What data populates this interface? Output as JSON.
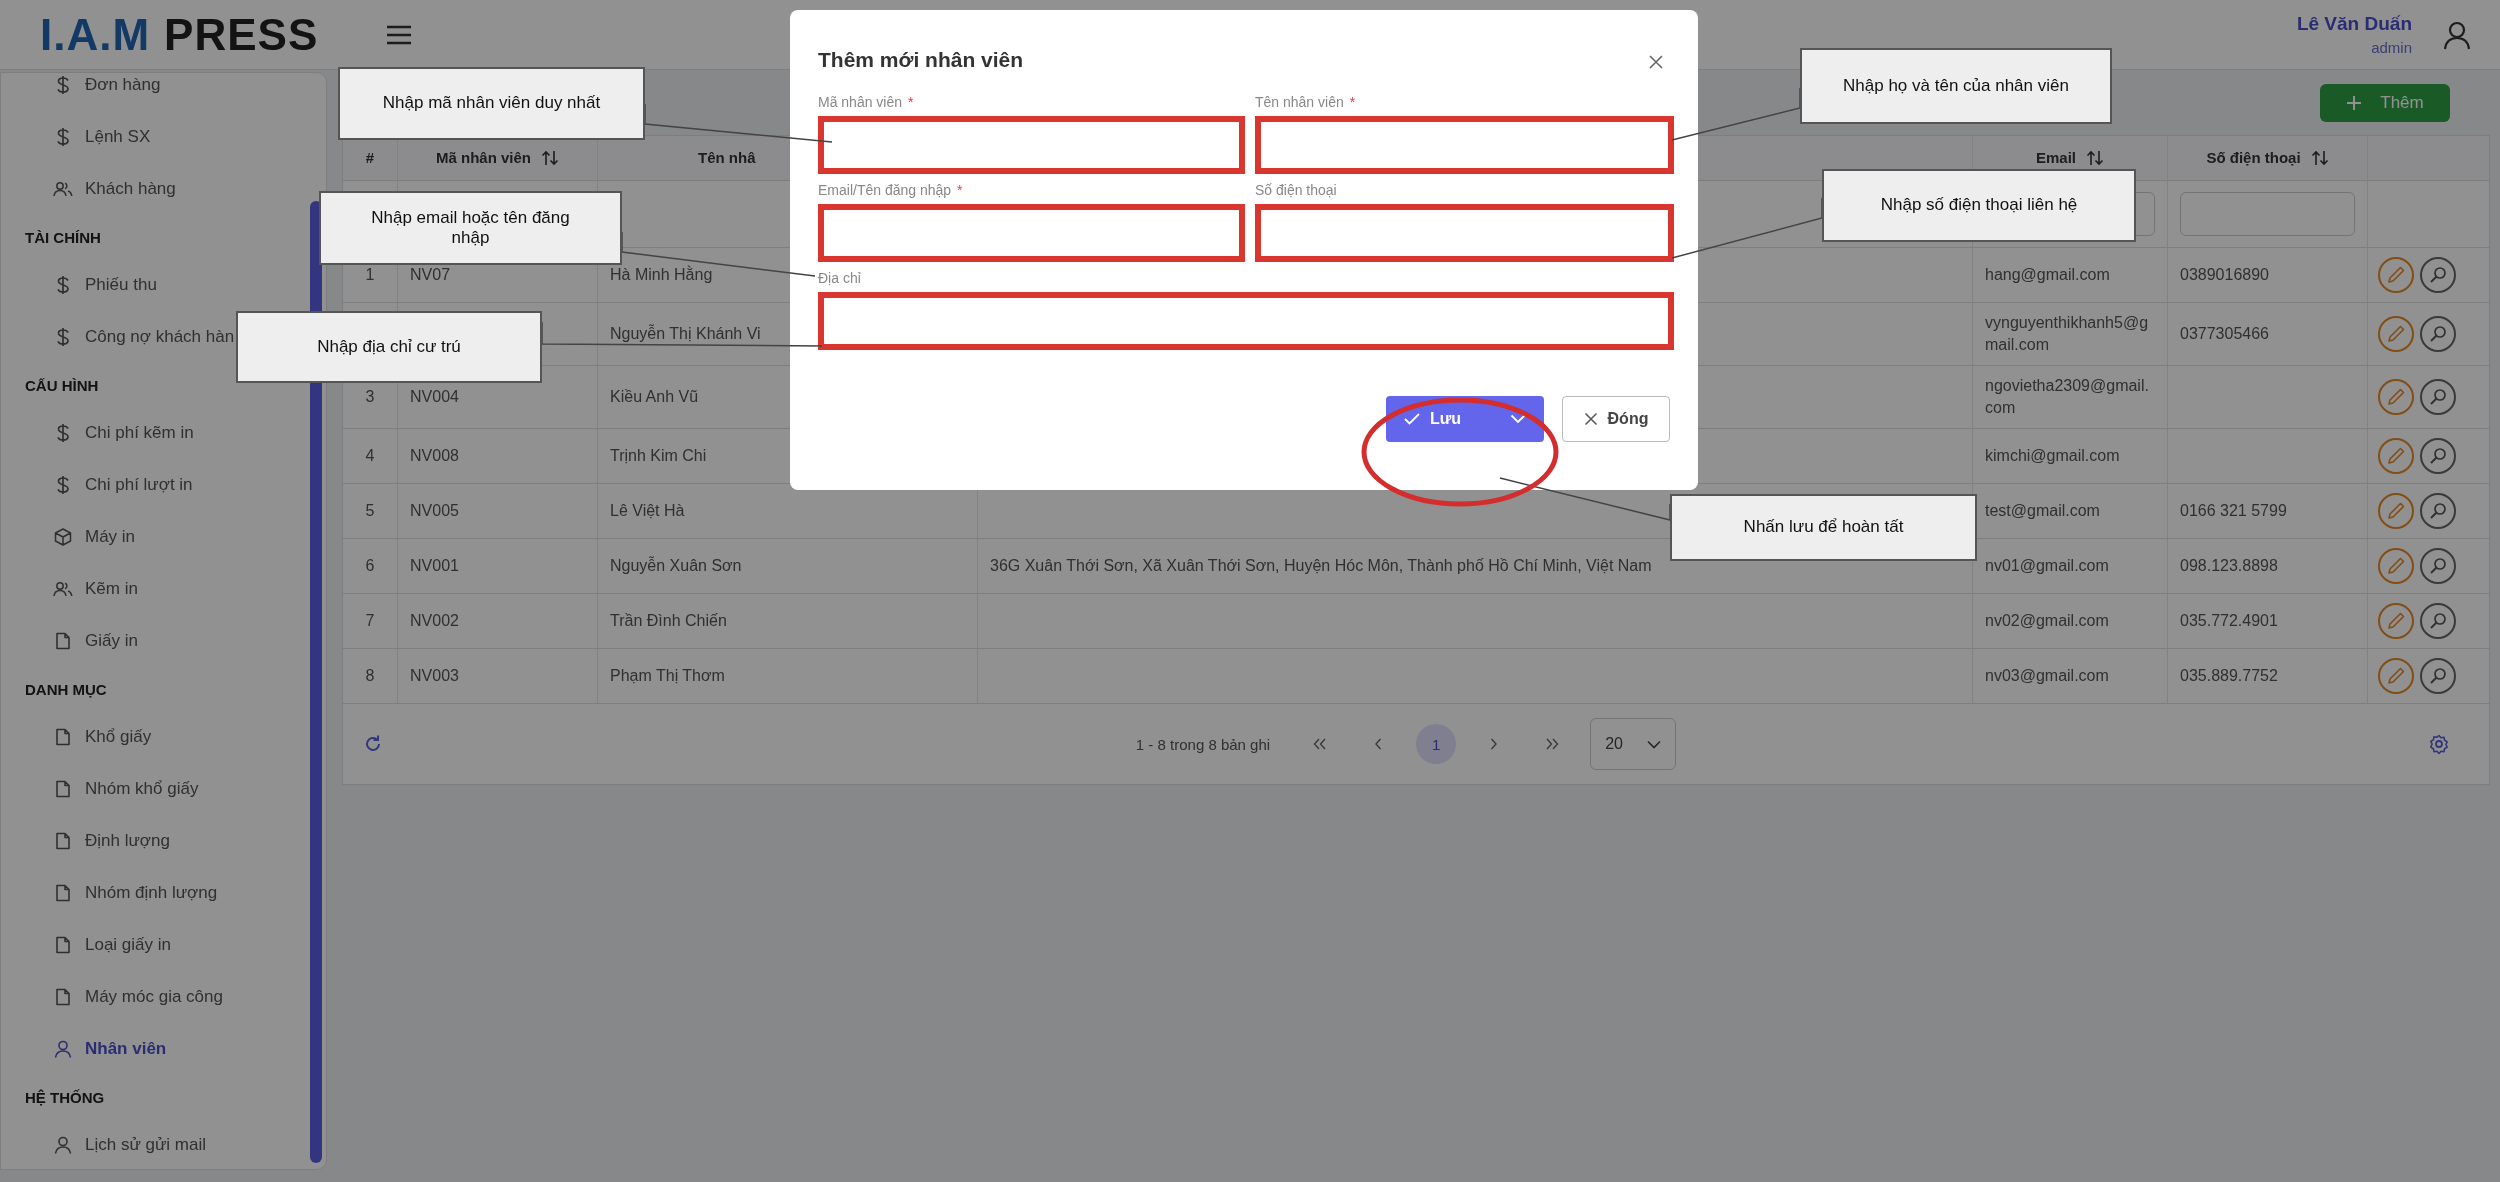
{
  "header": {
    "logo": {
      "mark": "I.A.M",
      "word": "PRESS"
    },
    "user": {
      "name": "Lê Văn Duấn",
      "role": "admin"
    }
  },
  "sidebar": {
    "sections": [
      {
        "items": [
          {
            "label": "Đơn hàng",
            "kind": "money",
            "selected": false
          },
          {
            "label": "Lệnh SX",
            "kind": "money",
            "selected": false
          },
          {
            "label": "Khách hàng",
            "kind": "people",
            "selected": false
          }
        ]
      },
      {
        "title": "TÀI CHÍNH",
        "items": [
          {
            "label": "Phiếu thu",
            "kind": "money",
            "selected": false
          },
          {
            "label": "Công nợ khách hàn",
            "kind": "money",
            "selected": false
          }
        ]
      },
      {
        "title": "CẤU HÌNH",
        "items": [
          {
            "label": "Chi phí kẽm in",
            "kind": "money",
            "selected": false
          },
          {
            "label": "Chi phí lượt in",
            "kind": "money",
            "selected": false
          },
          {
            "label": "Máy in",
            "kind": "box",
            "selected": false
          },
          {
            "label": "Kẽm in",
            "kind": "people",
            "selected": false
          },
          {
            "label": "Giấy in",
            "kind": "document",
            "selected": false
          }
        ]
      },
      {
        "title": "DANH MỤC",
        "items": [
          {
            "label": "Khổ giấy",
            "kind": "document",
            "selected": false
          },
          {
            "label": "Nhóm khổ giấy",
            "kind": "document",
            "selected": false
          },
          {
            "label": "Định lượng",
            "kind": "document",
            "selected": false
          },
          {
            "label": "Nhóm định lượng",
            "kind": "document",
            "selected": false
          },
          {
            "label": "Loại giấy in",
            "kind": "document",
            "selected": false
          },
          {
            "label": "Máy móc gia công",
            "kind": "document",
            "selected": false
          },
          {
            "label": "Nhân viên",
            "kind": "person",
            "selected": true
          }
        ]
      },
      {
        "title": "HỆ THỐNG",
        "items": [
          {
            "label": "Lịch sử gửi mail",
            "kind": "person",
            "selected": false
          }
        ]
      }
    ]
  },
  "toolbar": {
    "add_button": "Thêm"
  },
  "table": {
    "columns": [
      {
        "label": "#"
      },
      {
        "label": "Mã nhân viên",
        "sortable": true
      },
      {
        "label": "Tên nhâ"
      },
      {},
      {
        "label": "Email",
        "sortable": true,
        "filter": true
      },
      {
        "label": "Số điện thoại",
        "sortable": true,
        "filter": true
      },
      {}
    ],
    "rows": [
      {
        "index": "1",
        "code": "NV07",
        "name": "Hà Minh Hằng",
        "email": "hang@gmail.com",
        "phone": "0389016890"
      },
      {
        "name": "Nguyễn Thị Khánh Vi",
        "email": "vynguyenthikhanh5@gmail.com",
        "phone": "0377305466"
      },
      {
        "index": "3",
        "code": "NV004",
        "name": "Kiều Anh Vũ",
        "email": "ngovietha2309@gmail.com"
      },
      {
        "index": "4",
        "code": "NV008",
        "name": "Trịnh Kim Chi",
        "email": "kimchi@gmail.com"
      },
      {
        "index": "5",
        "code": "NV005",
        "name": "Lê Việt Hà",
        "email": "test@gmail.com",
        "phone": "0166 321 5799"
      },
      {
        "index": "6",
        "code": "NV001",
        "name": "Nguyễn Xuân Sơn",
        "address": "36G Xuân Thới Sơn, Xã Xuân Thới Sơn, Huyện Hóc Môn, Thành phố Hồ Chí Minh, Việt Nam",
        "email": "nv01@gmail.com",
        "phone": "098.123.8898"
      },
      {
        "index": "7",
        "code": "NV002",
        "name": "Trần Đình Chiến",
        "email": "nv02@gmail.com",
        "phone": "035.772.4901"
      },
      {
        "index": "8",
        "code": "NV003",
        "name": "Phạm Thị Thơm",
        "email": "nv03@gmail.com",
        "phone": "035.889.7752"
      }
    ]
  },
  "pagination": {
    "summary": "1 - 8 trong 8 bản ghi",
    "pages": [
      {
        "label": "1",
        "selected": true
      }
    ],
    "page_size": "20"
  },
  "dialog": {
    "title": "Thêm mới nhân viên",
    "fields": [
      {
        "label": "Mã nhân viên",
        "required_mark": "*",
        "highlighted": true
      },
      {
        "label": "Tên nhân viên",
        "required_mark": "*",
        "highlighted": true
      },
      {
        "label": "Email/Tên đăng nhập",
        "required_mark": "*",
        "highlighted": true
      },
      {
        "label": "Số điện thoại",
        "highlighted": true
      },
      {
        "label": "Địa chỉ",
        "highlighted": true
      }
    ],
    "buttons": [
      {
        "label": "Lưu",
        "kind": "primary"
      },
      {
        "label": "Đóng",
        "kind": "secondary"
      }
    ]
  },
  "callouts": [
    {
      "text": "Nhập mã nhân viên duy nhất"
    },
    {
      "text": "Nhập họ và tên của nhân viên"
    },
    {
      "text": "Nhập email hoặc tên đăng nhập"
    },
    {
      "text": "Nhập số điện thoại liên hệ"
    },
    {
      "text": "Nhập địa chỉ cư trú"
    },
    {
      "text": "Nhấn lưu để hoàn tất"
    }
  ]
}
